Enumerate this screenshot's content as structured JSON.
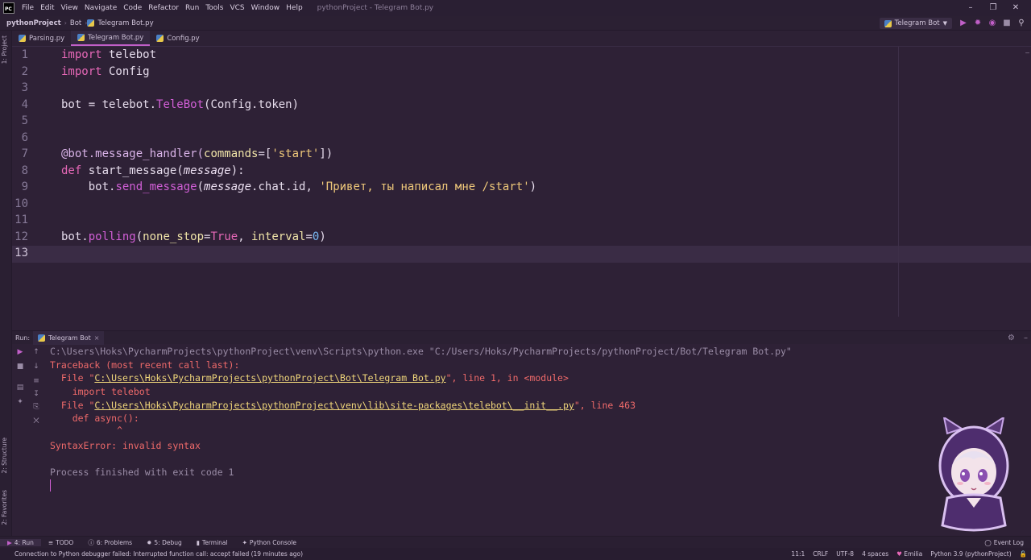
{
  "menubar": {
    "items": [
      "File",
      "Edit",
      "View",
      "Navigate",
      "Code",
      "Refactor",
      "Run",
      "Tools",
      "VCS",
      "Window",
      "Help"
    ],
    "title": "pythonProject - Telegram Bot.py"
  },
  "navbar": {
    "breadcrumbs": [
      "pythonProject",
      "Bot",
      "Telegram Bot.py"
    ],
    "run_config": "Telegram Bot"
  },
  "left_strip": {
    "project": "1: Project",
    "structure": "2: Structure",
    "favorites": "2: Favorites"
  },
  "tabs": [
    {
      "label": "Parsing.py"
    },
    {
      "label": "Telegram Bot.py"
    },
    {
      "label": "Config.py"
    }
  ],
  "editor": {
    "line_numbers": [
      "1",
      "2",
      "3",
      "4",
      "5",
      "6",
      "7",
      "8",
      "9",
      "10",
      "11",
      "12",
      "13"
    ],
    "tokens": {
      "import": "import",
      "telebot": " telebot",
      "config": " Config",
      "bot_eq": "bot = telebot.",
      "telebot_cls": "TeleBot",
      "cfg_token": "(Config.token)",
      "deco": "@bot.message_handler(",
      "commands": "commands",
      "eq_br": "=[",
      "start_str": "'start'",
      "close_br": "])",
      "def": "def",
      "func": " start_message(",
      "param": "message",
      "colon": "):",
      "indent_bot": "    bot.",
      "send_fn": "send_message",
      "open": "(",
      "msg_chat": ".chat.id, ",
      "msg_str": "'Привет, ты написал мне /start'",
      "close": ")",
      "bot_dot": "bot.",
      "polling": "polling",
      "none_stop": "none_stop",
      "eq": "=",
      "true": "True",
      "comma": ", ",
      "interval": "interval",
      "zero": "0"
    }
  },
  "run": {
    "label": "Run:",
    "tab": "Telegram Bot",
    "lines": {
      "cmd": "C:\\Users\\Hoks\\PycharmProjects\\pythonProject\\venv\\Scripts\\python.exe \"C:/Users/Hoks/PycharmProjects/pythonProject/Bot/Telegram Bot.py\"",
      "traceback": "Traceback (most recent call last):",
      "file1_pre": "  File \"",
      "file1_link": "C:\\Users\\Hoks\\PycharmProjects\\pythonProject\\Bot\\Telegram Bot.py",
      "file1_post": "\", line 1, in <module>",
      "import_line": "    import telebot",
      "file2_pre": "  File \"",
      "file2_link": "C:\\Users\\Hoks\\PycharmProjects\\pythonProject\\venv\\lib\\site-packages\\telebot\\__init__.py",
      "file2_post": "\", line 463",
      "def_line": "    def async():",
      "caret": "            ^",
      "syntax_error": "SyntaxError: invalid syntax",
      "finished": "Process finished with exit code 1"
    }
  },
  "bottom_tabs": [
    "4: Run",
    "TODO",
    "6: Problems",
    "5: Debug",
    "Terminal",
    "Python Console"
  ],
  "event_log": "Event Log",
  "status": {
    "message": "Connection to Python debugger failed: Interrupted function call: accept failed (19 minutes ago)",
    "position": "11:1",
    "line_sep": "CRLF",
    "encoding": "UTF-8",
    "indent": "4 spaces",
    "theme": "Emilia",
    "interpreter": "Python 3.9 (pythonProject)"
  },
  "colors": {
    "accent": "#c15fc8",
    "background": "#2e2136",
    "keyword": "#e668b7",
    "string": "#efc87a",
    "error": "#ef6a6a"
  }
}
